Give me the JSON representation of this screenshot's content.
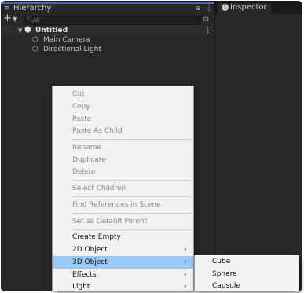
{
  "hierarchy": {
    "tab_icon": "list-icon",
    "title": "Hierarchy",
    "lock_glyph": "a",
    "menu_glyph": "⋮",
    "search_placeholder": "All",
    "scene": {
      "name": "Untitled",
      "menu_glyph": "⋮"
    },
    "objects": [
      {
        "name": "Main Camera",
        "icon": "cube-icon"
      },
      {
        "name": "Directional Light",
        "icon": "cube-icon"
      }
    ]
  },
  "inspector": {
    "title": "Inspector",
    "tab_icon": "info-icon"
  },
  "context_menu": {
    "items": [
      {
        "label": "Cut",
        "enabled": false
      },
      {
        "label": "Copy",
        "enabled": false
      },
      {
        "label": "Paste",
        "enabled": false
      },
      {
        "label": "Paste As Child",
        "enabled": false
      },
      {
        "label": "Rename",
        "enabled": false
      },
      {
        "label": "Duplicate",
        "enabled": false
      },
      {
        "label": "Delete",
        "enabled": false
      },
      {
        "label": "Select Children",
        "enabled": false
      },
      {
        "label": "Find References in Scene",
        "enabled": false
      },
      {
        "label": "Set as Default Parent",
        "enabled": false
      },
      {
        "label": "Create Empty",
        "enabled": true
      },
      {
        "label": "2D Object",
        "enabled": true,
        "submenu": true
      },
      {
        "label": "3D Object",
        "enabled": true,
        "submenu": true,
        "highlighted": true
      },
      {
        "label": "Effects",
        "enabled": true,
        "submenu": true
      },
      {
        "label": "Light",
        "enabled": true,
        "submenu": true
      }
    ],
    "submenu_arrow": "›"
  },
  "submenu_3d_object": {
    "items": [
      {
        "label": "Cube"
      },
      {
        "label": "Sphere"
      },
      {
        "label": "Capsule"
      }
    ]
  },
  "colors": {
    "highlight": "#99c9f6",
    "panel_bg": "#282828",
    "menu_bg": "#f2f2f2",
    "tab_accent": "#3a72b0"
  }
}
